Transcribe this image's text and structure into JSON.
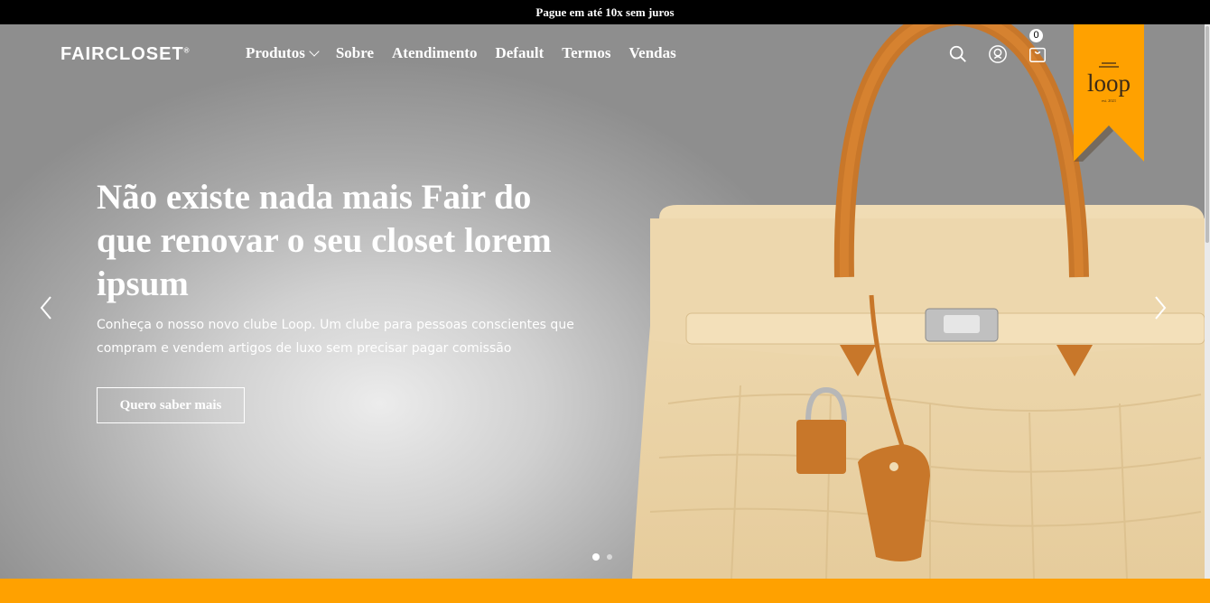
{
  "topbar": {
    "text": "Pague em até 10x sem juros"
  },
  "header": {
    "logo_text": "FAIRCLOSET",
    "logo_mark": "®",
    "nav": [
      {
        "label": "Produtos",
        "has_dropdown": true
      },
      {
        "label": "Sobre"
      },
      {
        "label": "Atendimento"
      },
      {
        "label": "Default"
      },
      {
        "label": "Termos"
      },
      {
        "label": "Vendas"
      }
    ],
    "icons": [
      "search-icon",
      "user-icon",
      "cart-icon"
    ],
    "cart_count": "0"
  },
  "ribbon": {
    "text": "loop",
    "est": "est. 2021",
    "color": "#ffa100"
  },
  "hero": {
    "headline": "Não existe nada mais Fair do que renovar o seu closet lorem ipsum",
    "subtitle": "Conheça o nosso novo clube Loop. Um clube para pessoas conscientes que compram e vendem artigos de luxo sem precisar pagar comissão",
    "cta_label": "Quero saber mais",
    "slides_total": 2,
    "active_slide": 1
  },
  "colors": {
    "accent": "#ffa100",
    "topbar": "#000000",
    "text": "#ffffff"
  }
}
